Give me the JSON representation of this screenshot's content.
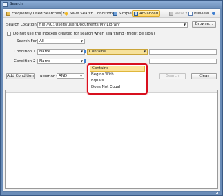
{
  "window": {
    "title": "Search"
  },
  "toolbar": {
    "frequent": "Frequently Used Searches",
    "save": "Save Search Condition",
    "simple": "Simple",
    "advanced": "Advanced",
    "view": "View",
    "preview": "Preview"
  },
  "location": {
    "label": "Search Location:",
    "value": "file:///C:/Users/user/Documents/My Library",
    "browse": "Browse..."
  },
  "options": {
    "no_index_label": "Do not use the indexes created for search when searching (might be slow)"
  },
  "search_for": {
    "label": "Search For:",
    "value": "All"
  },
  "condition1": {
    "label": "Condition 1",
    "field": "Name",
    "operator": "Contains"
  },
  "condition2": {
    "label": "Condition 2",
    "field": "Name"
  },
  "actions": {
    "add": "Add Condition",
    "relation_label": "Relation:",
    "relation_value": "AND",
    "search": "Search",
    "clear": "Clear"
  },
  "operator_menu": {
    "items": [
      "Contains",
      "Begins With",
      "Equals",
      "Does Not Equal"
    ],
    "selected": "Contains"
  },
  "colors": {
    "highlight_border": "#d8101e",
    "selection": "#fbe39a",
    "titlebar": "#6b8db8"
  }
}
